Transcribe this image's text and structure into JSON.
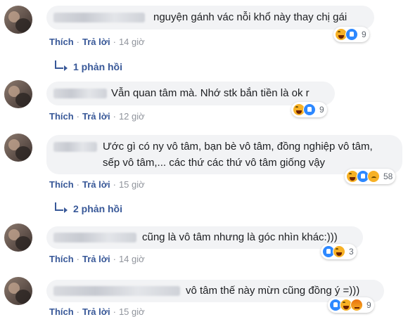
{
  "comments": [
    {
      "text": "nguyện gánh vác nỗi khổ này thay chị gái",
      "actions": {
        "like": "Thích",
        "reply": "Trả lời",
        "time": "14 giờ"
      },
      "reactions": {
        "icons": [
          "haha-icon",
          "like-icon"
        ],
        "count": "9"
      },
      "replies": "1 phản hồi"
    },
    {
      "text": "Vẫn quan tâm mà. Nhớ stk bắn tiền là ok r",
      "actions": {
        "like": "Thích",
        "reply": "Trả lời",
        "time": "12 giờ"
      },
      "reactions": {
        "icons": [
          "haha-icon",
          "like-icon"
        ],
        "count": "9"
      }
    },
    {
      "text_line1": "Ước gì có ny vô tâm, bạn bè vô tâm, đồng nghiệp vô tâm,",
      "text_line2": "sếp vô tâm,... các thứ các thứ vô tâm giống vậy",
      "actions": {
        "like": "Thích",
        "reply": "Trả lời",
        "time": "15 giờ"
      },
      "reactions": {
        "icons": [
          "haha-icon",
          "like-icon",
          "sad-icon"
        ],
        "count": "58"
      },
      "replies": "2 phản hồi"
    },
    {
      "text": "cũng là vô tâm nhưng là góc nhìn khác:)))",
      "actions": {
        "like": "Thích",
        "reply": "Trả lời",
        "time": "14 giờ"
      },
      "reactions": {
        "icons": [
          "like-icon",
          "haha-icon"
        ],
        "count": "3"
      }
    },
    {
      "text": "vô tâm thế này mừn cũng đồng ý =)))",
      "actions": {
        "like": "Thích",
        "reply": "Trả lời",
        "time": "15 giờ"
      },
      "reactions": {
        "icons": [
          "like-icon",
          "haha-icon",
          "angry-icon"
        ],
        "count": "9"
      }
    }
  ],
  "colors": {
    "link": "#385898",
    "bubble": "#f2f3f5",
    "meta": "#90949c"
  }
}
